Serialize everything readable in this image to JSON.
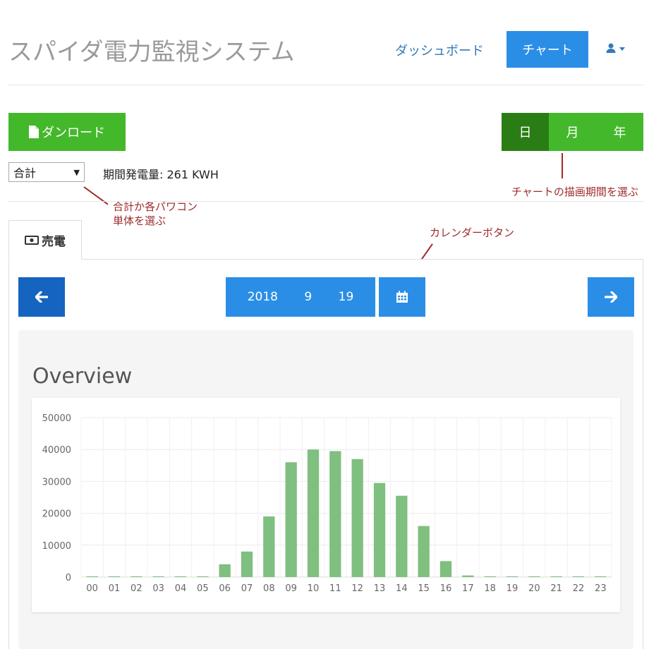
{
  "header": {
    "app_title": "スパイダ電力監視システム",
    "nav_dashboard": "ダッシュボード",
    "nav_chart": "チャート",
    "user_icon": "user-icon"
  },
  "toolbar": {
    "download_label": "ダンロード",
    "download_icon": "file-icon",
    "period_buttons": [
      "日",
      "月",
      "年"
    ],
    "period_active": "日"
  },
  "selector": {
    "selected": "合計",
    "total_generation": "期間発電量: 261 KWH"
  },
  "annotations": {
    "period": "チャートの描画期間を選ぶ",
    "select_line1": "合計か各パワコン",
    "select_line2": "単体を選ぶ",
    "calendar": "カレンダーボタン"
  },
  "tabs": {
    "sell_label": "売電",
    "sell_icon": "money-icon"
  },
  "date_nav": {
    "prev_icon": "arrow-left-icon",
    "next_icon": "arrow-right-icon",
    "calendar_icon": "calendar-icon",
    "year": "2018",
    "month": "9",
    "day": "19"
  },
  "overview": {
    "title": "Overview"
  },
  "colors": {
    "primary_blue": "#2b8ee6",
    "dark_blue": "#1565c0",
    "green": "#44b82b",
    "dark_green": "#2a7d15",
    "bar_green": "#7fbf7f",
    "annotation_red": "#9e2a2a"
  },
  "chart_data": {
    "type": "bar",
    "categories": [
      "00",
      "01",
      "02",
      "03",
      "04",
      "05",
      "06",
      "07",
      "08",
      "09",
      "10",
      "11",
      "12",
      "13",
      "14",
      "15",
      "16",
      "17",
      "18",
      "19",
      "20",
      "21",
      "22",
      "23"
    ],
    "values": [
      0,
      0,
      0,
      0,
      0,
      0,
      4000,
      8000,
      19000,
      36000,
      40000,
      39500,
      37000,
      29500,
      25500,
      16000,
      5000,
      500,
      0,
      0,
      0,
      0,
      0,
      0
    ],
    "ylim": [
      0,
      50000
    ],
    "yticks": [
      0,
      10000,
      20000,
      30000,
      40000,
      50000
    ],
    "grid": true
  }
}
